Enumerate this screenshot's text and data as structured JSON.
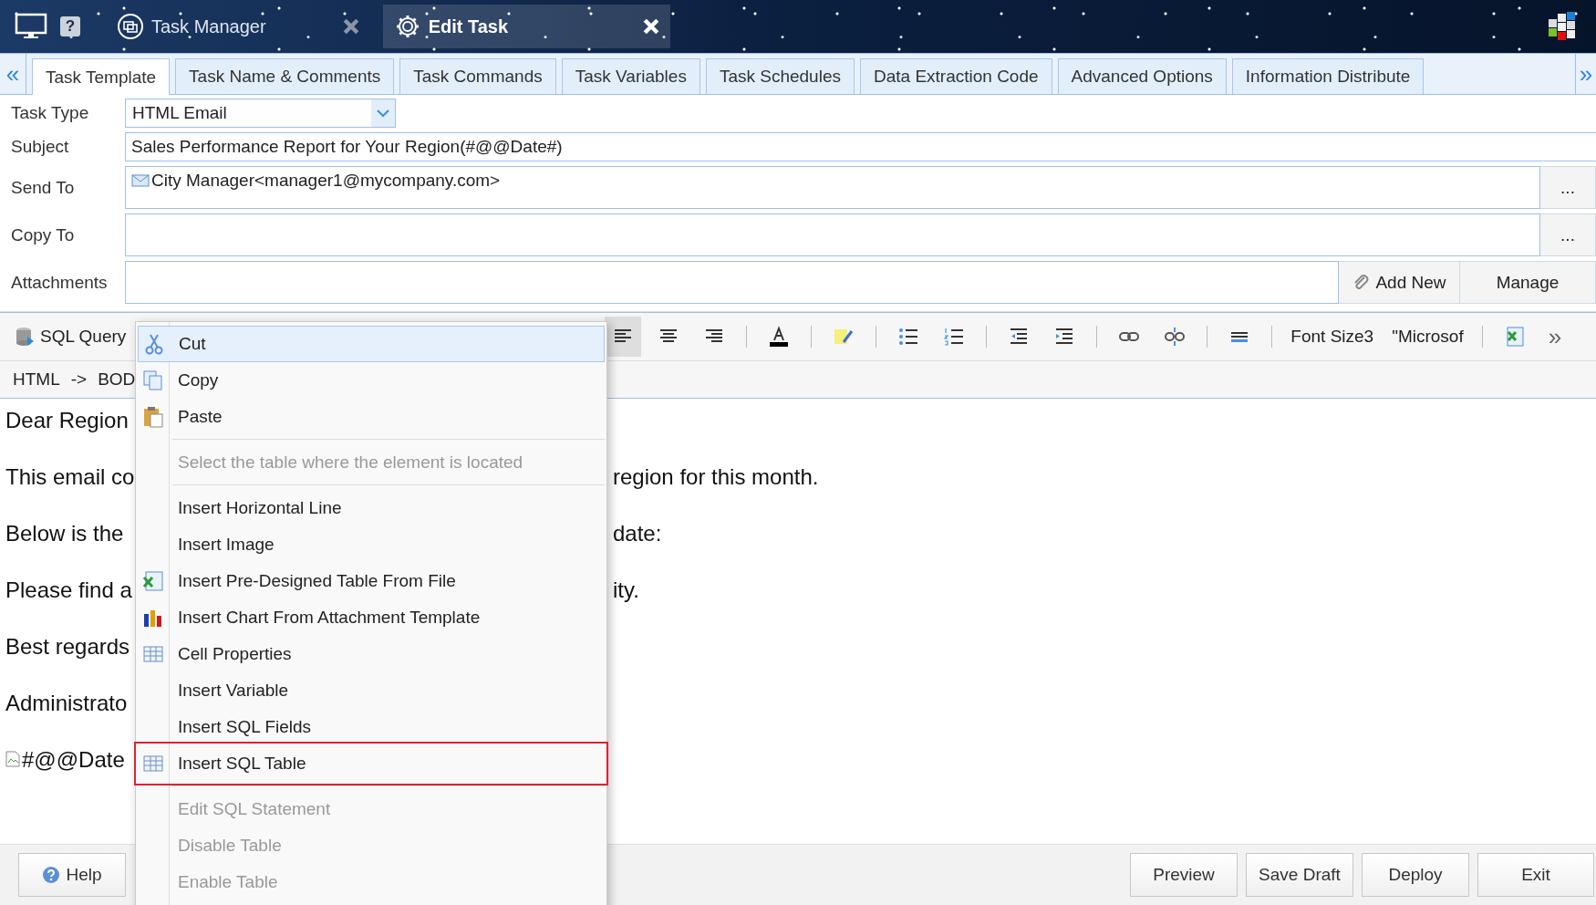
{
  "header": {
    "tabs": [
      {
        "label": "Task Manager",
        "selected": false
      },
      {
        "label": "Edit Task",
        "selected": true
      }
    ],
    "help_label": "?"
  },
  "tabs": {
    "prev": "«",
    "next": "»",
    "items": [
      {
        "label": "Task Template",
        "selected": true
      },
      {
        "label": "Task Name & Comments",
        "selected": false
      },
      {
        "label": "Task Commands",
        "selected": false
      },
      {
        "label": "Task Variables",
        "selected": false
      },
      {
        "label": "Task Schedules",
        "selected": false
      },
      {
        "label": "Data Extraction Code",
        "selected": false
      },
      {
        "label": "Advanced Options",
        "selected": false
      },
      {
        "label": "Information Distribute",
        "selected": false
      }
    ]
  },
  "form": {
    "task_type": {
      "label": "Task Type",
      "value": "HTML Email"
    },
    "subject": {
      "label": "Subject",
      "value": "Sales Performance Report for Your Region(#@@Date#)"
    },
    "send_to": {
      "label": "Send To",
      "recipients": [
        "City Manager<manager1@mycompany.com>"
      ],
      "button": "..."
    },
    "copy_to": {
      "label": "Copy To",
      "button": "..."
    },
    "attachments": {
      "label": "Attachments",
      "buttons": [
        "Add New",
        "Manage"
      ]
    }
  },
  "toolbar": {
    "sql_query": "SQL Query",
    "items": [
      {
        "kind": "align-left",
        "selected": true
      },
      {
        "kind": "align-center",
        "selected": false
      },
      {
        "kind": "align-right",
        "selected": false
      },
      {
        "kind": "separator"
      },
      {
        "kind": "font-color"
      },
      {
        "kind": "separator"
      },
      {
        "kind": "highlight"
      },
      {
        "kind": "separator"
      },
      {
        "kind": "bullet-list"
      },
      {
        "kind": "numbered-list"
      },
      {
        "kind": "separator"
      },
      {
        "kind": "outdent"
      },
      {
        "kind": "indent"
      },
      {
        "kind": "separator"
      },
      {
        "kind": "link"
      },
      {
        "kind": "unlink"
      },
      {
        "kind": "separator"
      },
      {
        "kind": "rule"
      },
      {
        "kind": "separator"
      },
      {
        "kind": "text",
        "label": "Font Size3"
      },
      {
        "kind": "text",
        "label": "\"Microsof"
      },
      {
        "kind": "separator"
      },
      {
        "kind": "excel"
      },
      {
        "kind": "more",
        "label": "»"
      }
    ]
  },
  "breadcrumb": [
    "HTML",
    "->",
    "BOD"
  ],
  "editor": {
    "paragraphs": [
      {
        "start": "Dear Region"
      },
      {
        "start": "This email co",
        "end": "region for this month."
      },
      {
        "start": "Below is the",
        "end": "date:"
      },
      {
        "start": "Please find a",
        "end": "ity."
      },
      {
        "start": "Best regards"
      },
      {
        "start": "Administrato"
      },
      {
        "kind": "image",
        "start": "#@@Date"
      }
    ]
  },
  "context_menu": {
    "items": [
      {
        "kind": "item",
        "label": "Cut",
        "selected": true,
        "disabled": false,
        "outlined": false
      },
      {
        "kind": "item",
        "label": "Copy",
        "selected": false,
        "disabled": false,
        "outlined": false
      },
      {
        "kind": "item",
        "label": "Paste",
        "selected": false,
        "disabled": false,
        "outlined": false
      },
      {
        "kind": "separator"
      },
      {
        "kind": "item",
        "label": "Select the table where the element is located",
        "selected": false,
        "disabled": true,
        "outlined": false
      },
      {
        "kind": "separator"
      },
      {
        "kind": "item",
        "label": "Insert Horizontal Line",
        "selected": false,
        "disabled": false,
        "outlined": false
      },
      {
        "kind": "item",
        "label": "Insert Image",
        "selected": false,
        "disabled": false,
        "outlined": false
      },
      {
        "kind": "item",
        "label": "Insert Pre-Designed Table From File",
        "selected": false,
        "disabled": false,
        "outlined": false
      },
      {
        "kind": "item",
        "label": "Insert Chart From Attachment Template",
        "selected": false,
        "disabled": false,
        "outlined": false
      },
      {
        "kind": "item",
        "label": "Cell Properties",
        "selected": false,
        "disabled": false,
        "outlined": false
      },
      {
        "kind": "item",
        "label": "Insert Variable",
        "selected": false,
        "disabled": false,
        "outlined": false
      },
      {
        "kind": "item",
        "label": "Insert SQL Fields",
        "selected": false,
        "disabled": false,
        "outlined": false
      },
      {
        "kind": "item",
        "label": "Insert SQL Table",
        "selected": false,
        "disabled": false,
        "outlined": true
      },
      {
        "kind": "separator"
      },
      {
        "kind": "item",
        "label": "Edit SQL Statement",
        "selected": false,
        "disabled": true,
        "outlined": false
      },
      {
        "kind": "item",
        "label": "Disable Table",
        "selected": false,
        "disabled": true,
        "outlined": false
      },
      {
        "kind": "item",
        "label": "Enable Table",
        "selected": false,
        "disabled": true,
        "outlined": false
      }
    ]
  },
  "footer": {
    "help": "Help",
    "buttons": [
      "Preview",
      "Save Draft",
      "Deploy",
      "Exit"
    ]
  }
}
